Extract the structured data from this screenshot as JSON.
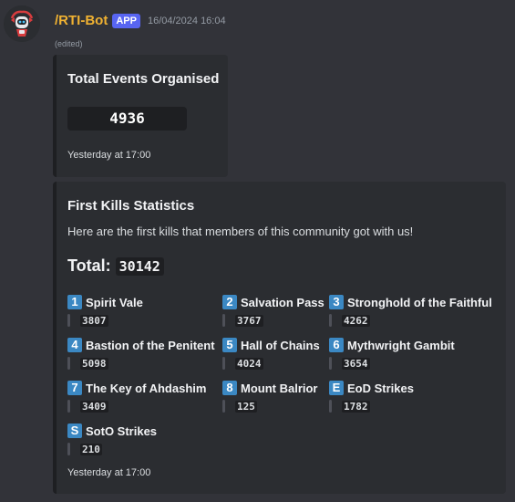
{
  "message": {
    "username": "/RTI-Bot",
    "badge": "APP",
    "timestamp": "16/04/2024 16:04",
    "edited": "(edited)"
  },
  "embed_events": {
    "title": "Total Events Organised",
    "value": "4936",
    "footer": "Yesterday at 17:00"
  },
  "embed_kills": {
    "title": "First Kills Statistics",
    "description": "Here are the first kills that members of this community got with us!",
    "total_label": "Total:",
    "total_value": "30142",
    "footer": "Yesterday at 17:00",
    "fields": [
      {
        "icon": "1",
        "name": "Spirit Vale",
        "value": "3807"
      },
      {
        "icon": "2",
        "name": "Salvation Pass",
        "value": "3767"
      },
      {
        "icon": "3",
        "name": "Stronghold of the Faithful",
        "value": "4262"
      },
      {
        "icon": "4",
        "name": "Bastion of the Penitent",
        "value": "5098"
      },
      {
        "icon": "5",
        "name": "Hall of Chains",
        "value": "4024"
      },
      {
        "icon": "6",
        "name": "Mythwright Gambit",
        "value": "3654"
      },
      {
        "icon": "7",
        "name": "The Key of Ahdashim",
        "value": "3409"
      },
      {
        "icon": "8",
        "name": "Mount Balrior",
        "value": "125"
      },
      {
        "icon": "E",
        "name": "EoD Strikes",
        "value": "1782"
      },
      {
        "icon": "S",
        "name": "SotO Strikes",
        "value": "210"
      }
    ]
  },
  "colors": {
    "background": "#323339",
    "embed_background": "#2b2d31",
    "username": "#f0b232",
    "app_badge": "#5865f2",
    "keycap_icon": "#3b88c3"
  },
  "icons": {
    "avatar": "robot-avatar-icon",
    "field_icons": "keycap-icon"
  }
}
